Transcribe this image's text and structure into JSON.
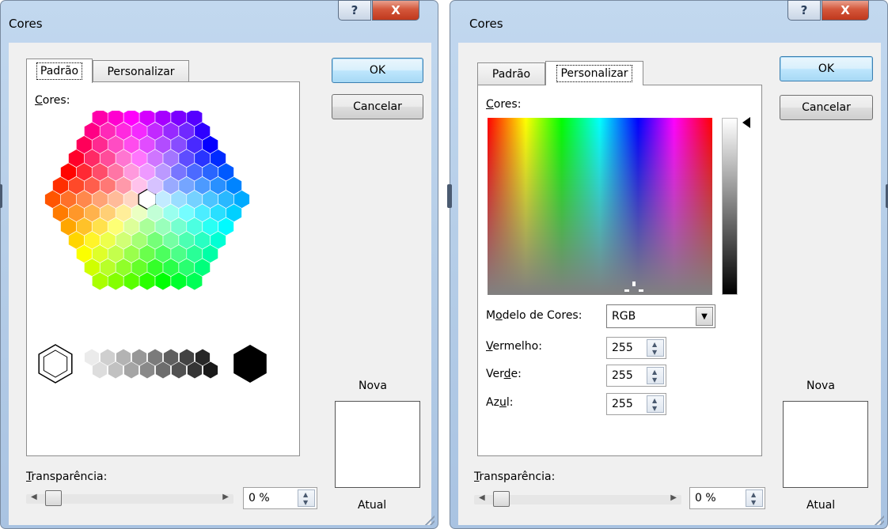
{
  "left_dialog": {
    "title": "Cores",
    "help_glyph": "?",
    "close_glyph": "X",
    "tabs": [
      {
        "label": "Padrão",
        "active": true
      },
      {
        "label": "Personalizar",
        "active": false
      }
    ],
    "colors_label": "Cores:",
    "ok_label": "OK",
    "cancel_label": "Cancelar",
    "new_label": "Nova",
    "current_label": "Atual",
    "transparency_label": "Transparência:",
    "transparency_value": "0 %",
    "transparency_level": 0
  },
  "right_dialog": {
    "title": "Cores",
    "help_glyph": "?",
    "close_glyph": "X",
    "tabs": [
      {
        "label": "Padrão",
        "active": false
      },
      {
        "label": "Personalizar",
        "active": true
      }
    ],
    "colors_label": "Cores:",
    "ok_label": "OK",
    "cancel_label": "Cancelar",
    "color_model_label": "Modelo de Cores:",
    "color_model_value": "RGB",
    "red_label": "Vermelho:",
    "red_value": "255",
    "green_label": "Verde:",
    "green_value": "255",
    "blue_label": "Azul:",
    "blue_value": "255",
    "new_label": "Nova",
    "current_label": "Atual",
    "transparency_label": "Transparência:",
    "transparency_value": "0 %",
    "transparency_level": 0
  },
  "icons": {
    "help": "help-icon",
    "close": "close-icon",
    "spin_up": "spin-up-icon",
    "spin_down": "spin-down-icon",
    "dropdown": "chevron-down-icon",
    "scroll_left": "scroll-left-icon",
    "scroll_right": "scroll-right-icon",
    "luminance_marker": "luminance-arrow-icon",
    "resize_grip": "resize-grip-icon"
  }
}
